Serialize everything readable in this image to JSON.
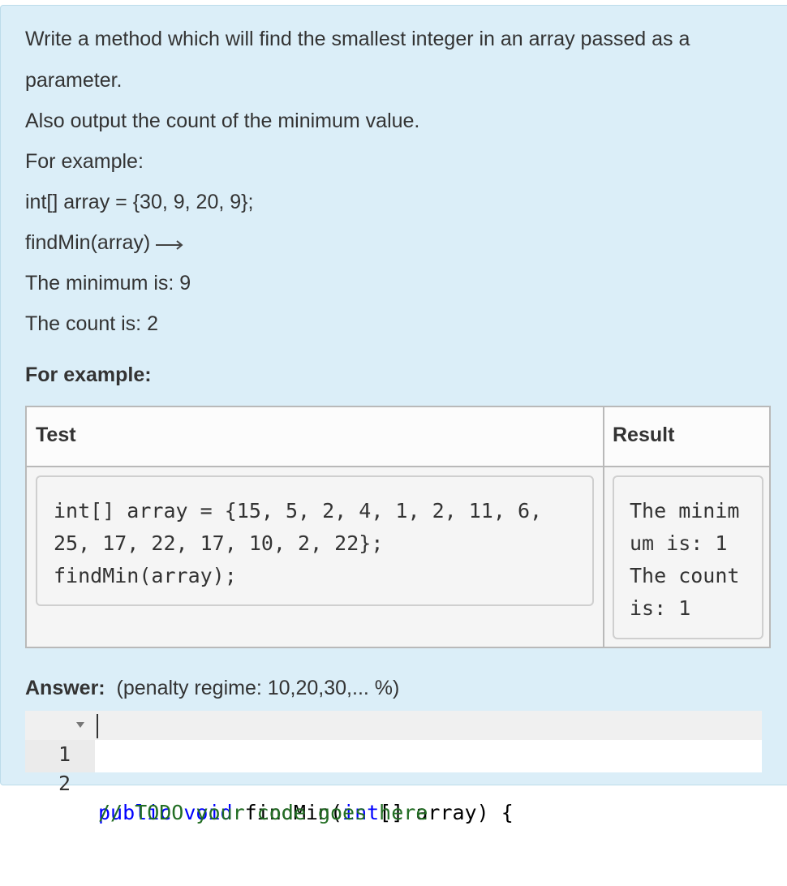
{
  "question": {
    "line1": "Write a method which will find the smallest integer in an array passed as a",
    "line2": "parameter.",
    "line3": "Also output the count of the minimum value.",
    "line4": "For example:",
    "line5": "int[] array = {30, 9, 20, 9};",
    "line6": "findMin(array)",
    "line7": "The minimum is: 9",
    "line8": "The count is: 2"
  },
  "examples": {
    "heading": "For example:",
    "col_test": "Test",
    "col_result": "Result",
    "test_code": "int[] array = {15, 5, 2, 4, 1, 2, 11, 6,\n25, 17, 22, 17, 10, 2, 22};\nfindMin(array);",
    "result_text": "The minim\num is: 1\nThe count\nis: 1"
  },
  "answer": {
    "label": "Answer:",
    "penalty": "(penalty regime: 10,20,30,... %)"
  },
  "editor": {
    "lines": [
      {
        "num": "1",
        "kw": "public void",
        "rest1": " findMin(",
        "kw2": "int",
        "rest2": "[] array) {"
      },
      {
        "num": "2",
        "comment": "// TODO your code goes here"
      }
    ]
  },
  "icons": {
    "arrow": "long-right-arrow-icon",
    "fold": "fold-triangle-icon"
  }
}
